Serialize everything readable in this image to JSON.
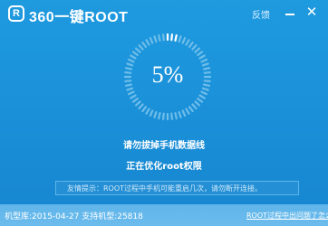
{
  "titlebar": {
    "logo_glyph": "R",
    "title": "360一键ROOT",
    "feedback": "反馈",
    "minimize_icon": "minimize-icon",
    "close_icon": "close-icon",
    "close_glyph": "✕"
  },
  "progress": {
    "percent_label": "5%",
    "value": 0.05,
    "ring_color": "#ffffff",
    "track_color": "#6fbde9"
  },
  "status": {
    "line1": "请勿拔掉手机数据线",
    "line2": "正在优化root权限"
  },
  "notice": {
    "text": "友情提示：ROOT过程中手机可能重启几次，请勿断开连接。"
  },
  "footer": {
    "device_info": "机型库:2015-04-27 支持机型:25818",
    "help_link": "ROOT过程中出问题了怎么办"
  },
  "colors": {
    "background": "#1a8fd8",
    "footer_background": "#6cbced",
    "text": "#ffffff"
  }
}
